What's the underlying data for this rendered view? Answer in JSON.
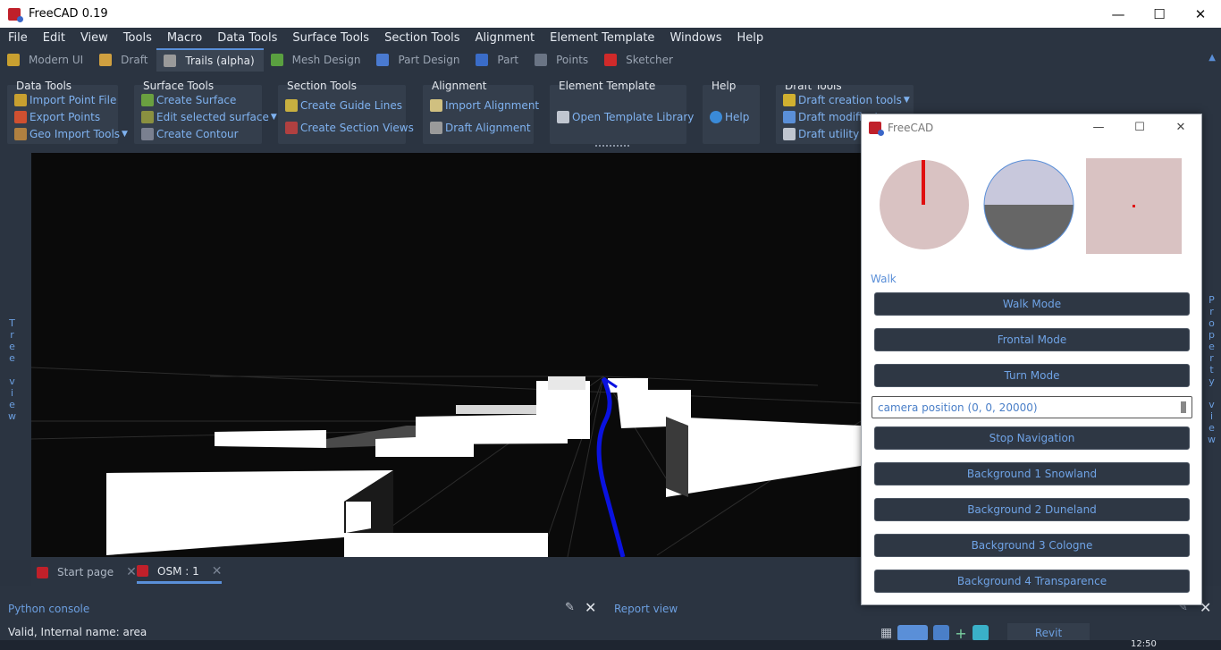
{
  "window": {
    "title": "FreeCAD 0.19",
    "min": "—",
    "max": "☐",
    "close": "✕"
  },
  "menu": [
    "File",
    "Edit",
    "View",
    "Tools",
    "Macro",
    "Data Tools",
    "Surface Tools",
    "Section Tools",
    "Alignment",
    "Element Template",
    "Windows",
    "Help"
  ],
  "workbenches": [
    {
      "label": "Modern UI",
      "color": "#c8a030"
    },
    {
      "label": "Draft",
      "color": "#d0a040"
    },
    {
      "label": "Trails (alpha)",
      "color": "#9a9a9a",
      "active": true
    },
    {
      "label": "Mesh Design",
      "color": "#5aa040"
    },
    {
      "label": "Part Design",
      "color": "#4a7ad0"
    },
    {
      "label": "Part",
      "color": "#3a6cc8"
    },
    {
      "label": "Points",
      "color": "#9aa4b2"
    },
    {
      "label": "Sketcher",
      "color": "#d02a2a"
    }
  ],
  "toolbars": {
    "data_tools": {
      "title": "Data Tools",
      "items": [
        "Import Point File",
        "Export Points",
        "Geo Import Tools"
      ]
    },
    "surface_tools": {
      "title": "Surface Tools",
      "items": [
        "Create Surface",
        "Edit selected surface",
        "Create Contour"
      ]
    },
    "section_tools": {
      "title": "Section Tools",
      "items": [
        "Create Guide Lines",
        "Create Section Views"
      ]
    },
    "alignment": {
      "title": "Alignment",
      "items": [
        "Import Alignment",
        "Draft Alignment"
      ]
    },
    "element_template": {
      "title": "Element Template",
      "items": [
        "Open Template Library"
      ]
    },
    "help": {
      "title": "Help",
      "items": [
        "Help"
      ]
    },
    "draft_tools": {
      "title": "Draft Tools",
      "items": [
        "Draft creation tools",
        "Draft modificat",
        "Draft utility too"
      ]
    }
  },
  "side": {
    "left": "Tree view",
    "right": "Property view"
  },
  "doc_tabs": [
    {
      "label": "Start page"
    },
    {
      "label": "OSM : 1",
      "active": true
    }
  ],
  "panels": {
    "python_console": "Python console",
    "report_view": "Report view",
    "revit": "Revit"
  },
  "status": "Valid, Internal name: area",
  "clock": "12:50",
  "dialog": {
    "title": "FreeCAD",
    "section_label": "Walk",
    "buttons_top": [
      "Walk Mode",
      "Frontal Mode",
      "Turn Mode"
    ],
    "camera_field": "camera position (0, 0, 20000)",
    "buttons_bottom": [
      "Stop Navigation",
      "Background 1 Snowland",
      "Background 2 Duneland",
      "Background 3 Cologne",
      "Background 4 Transparence"
    ]
  },
  "colors": {
    "accent": "#5a8fd8",
    "path": "#0a12e0",
    "compass_needle": "#e01010"
  }
}
